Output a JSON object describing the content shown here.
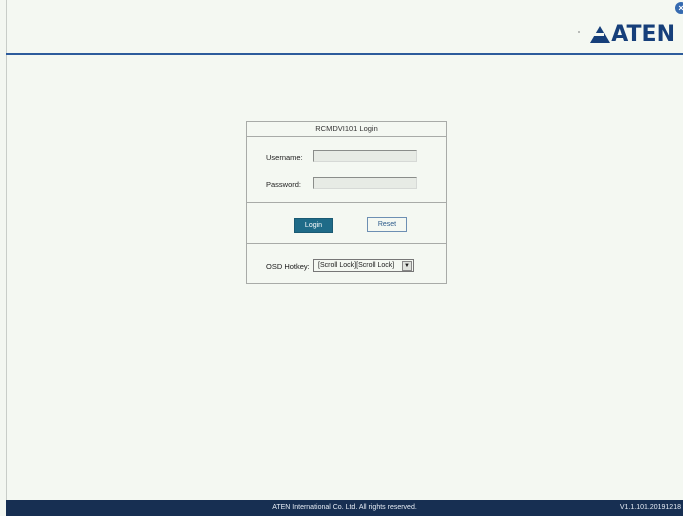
{
  "header": {
    "logo_text": "ATEN",
    "close_label": "×"
  },
  "login": {
    "title": "RCMDVI101 Login",
    "username_label": "Username:",
    "username_value": "",
    "password_label": "Password:",
    "password_value": "",
    "login_button": "Login",
    "reset_button": "Reset",
    "hotkey_label": "OSD Hotkey:",
    "hotkey_value": "[Scroll Lock][Scroll Lock]",
    "hotkey_arrow": "▼"
  },
  "footer": {
    "copyright": "ATEN International Co. Ltd. All rights reserved.",
    "version": "V1.1.101.20191218"
  },
  "colors": {
    "brand": "#163f7a",
    "footer_bg": "#172f52",
    "login_button": "#1f6b88"
  }
}
